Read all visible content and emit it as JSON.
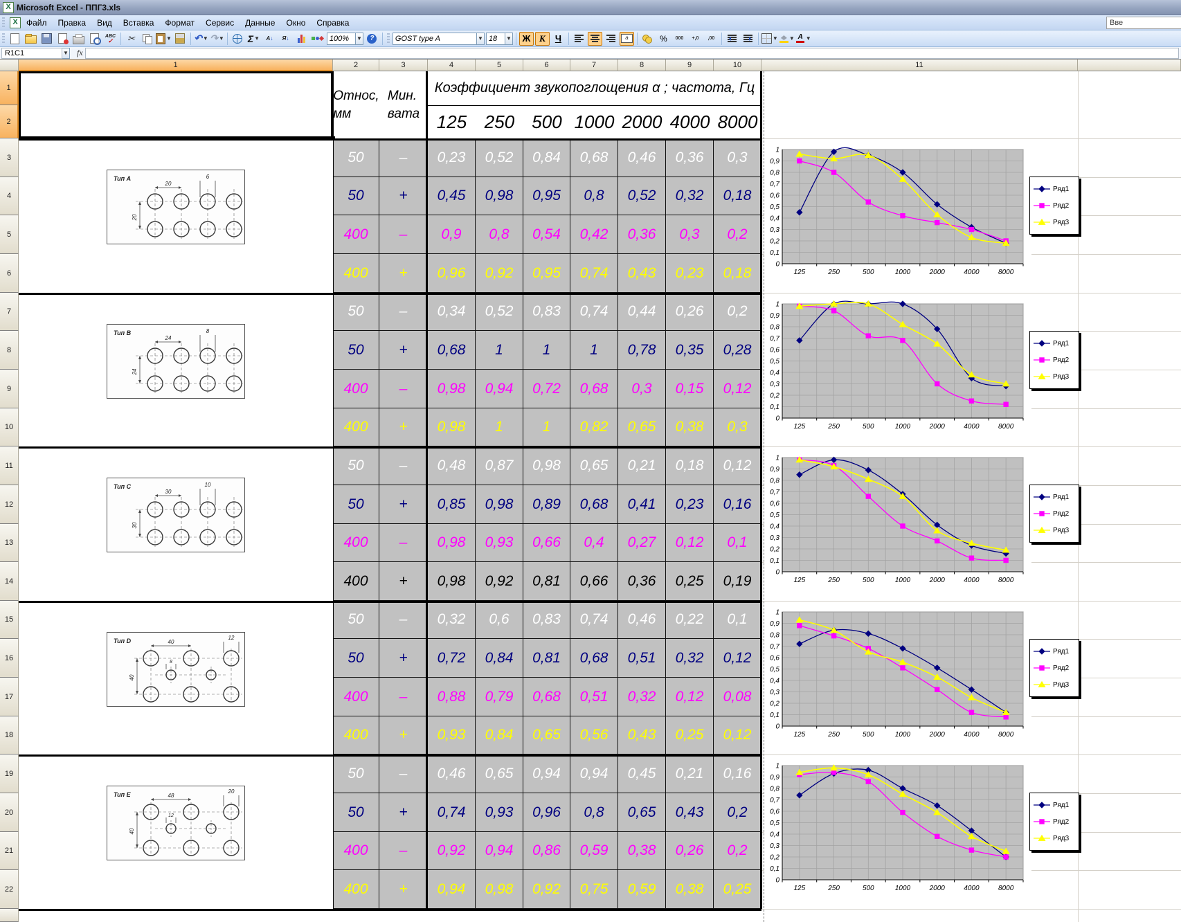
{
  "window": {
    "title": "Microsoft Excel - ППГ3.xls"
  },
  "menu": {
    "items": [
      "Файл",
      "Правка",
      "Вид",
      "Вставка",
      "Формат",
      "Сервис",
      "Данные",
      "Окно",
      "Справка"
    ],
    "question_box": "Вве"
  },
  "toolbar": {
    "zoom_value": "100%",
    "font_name": "GOST type A",
    "font_size": "18",
    "bold_label": "Ж",
    "italic_label": "К",
    "underline_label": "Ч",
    "percent_label": "%",
    "thousands_label": "000",
    "inc_decimal_label": "+,0",
    "dec_decimal_label": ",00",
    "font_color_label": "А",
    "help_label": "?",
    "sort_az_label": "А",
    "sort_za_label": "Я"
  },
  "formula_bar": {
    "name_box": "R1C1",
    "fx": "fx"
  },
  "sheet": {
    "col_headers": [
      "1",
      "2",
      "3",
      "4",
      "5",
      "6",
      "7",
      "8",
      "9",
      "10",
      "11"
    ],
    "row_headers": [
      "1",
      "2",
      "3",
      "4",
      "5",
      "6",
      "7",
      "8",
      "9",
      "10",
      "11",
      "12",
      "13",
      "14",
      "15",
      "16",
      "17",
      "18",
      "19",
      "20",
      "21",
      "22"
    ],
    "header": {
      "col2_line1": "Относ,",
      "col2_line2": "мм",
      "col3_line1": "Мин.",
      "col3_line2": "вата",
      "title": "Коэффициент звукопоглощения α ; частота, Гц",
      "frequencies": [
        "125",
        "250",
        "500",
        "1000",
        "2000",
        "4000",
        "8000"
      ]
    },
    "blocks": [
      {
        "id": "a",
        "drawing": {
          "label": "Тип A",
          "pattern": "grid",
          "pitch": "20",
          "dia": "6",
          "vpitch": "20"
        },
        "rows": [
          {
            "offset": "50",
            "wool": "–",
            "color": "#ffffff",
            "values": [
              "0,23",
              "0,52",
              "0,84",
              "0,68",
              "0,46",
              "0,36",
              "0,3"
            ]
          },
          {
            "offset": "50",
            "wool": "+",
            "color": "#000080",
            "values": [
              "0,45",
              "0,98",
              "0,95",
              "0,8",
              "0,52",
              "0,32",
              "0,18"
            ]
          },
          {
            "offset": "400",
            "wool": "–",
            "color": "#ff00ff",
            "values": [
              "0,9",
              "0,8",
              "0,54",
              "0,42",
              "0,36",
              "0,3",
              "0,2"
            ]
          },
          {
            "offset": "400",
            "wool": "+",
            "color": "#ffff00",
            "values": [
              "0,96",
              "0,92",
              "0,95",
              "0,74",
              "0,43",
              "0,23",
              "0,18"
            ]
          }
        ]
      },
      {
        "id": "b",
        "drawing": {
          "label": "Тип B",
          "pattern": "grid",
          "pitch": "24",
          "dia": "8",
          "vpitch": "24"
        },
        "rows": [
          {
            "offset": "50",
            "wool": "–",
            "color": "#ffffff",
            "values": [
              "0,34",
              "0,52",
              "0,83",
              "0,74",
              "0,44",
              "0,26",
              "0,2"
            ]
          },
          {
            "offset": "50",
            "wool": "+",
            "color": "#000080",
            "values": [
              "0,68",
              "1",
              "1",
              "1",
              "0,78",
              "0,35",
              "0,28"
            ]
          },
          {
            "offset": "400",
            "wool": "–",
            "color": "#ff00ff",
            "values": [
              "0,98",
              "0,94",
              "0,72",
              "0,68",
              "0,3",
              "0,15",
              "0,12"
            ]
          },
          {
            "offset": "400",
            "wool": "+",
            "color": "#ffff00",
            "values": [
              "0,98",
              "1",
              "1",
              "0,82",
              "0,65",
              "0,38",
              "0,3"
            ]
          }
        ]
      },
      {
        "id": "c",
        "drawing": {
          "label": "Тип C",
          "pattern": "grid",
          "pitch": "30",
          "dia": "10",
          "vpitch": "30"
        },
        "rows": [
          {
            "offset": "50",
            "wool": "–",
            "color": "#ffffff",
            "values": [
              "0,48",
              "0,87",
              "0,98",
              "0,65",
              "0,21",
              "0,18",
              "0,12"
            ]
          },
          {
            "offset": "50",
            "wool": "+",
            "color": "#000080",
            "values": [
              "0,85",
              "0,98",
              "0,89",
              "0,68",
              "0,41",
              "0,23",
              "0,16"
            ]
          },
          {
            "offset": "400",
            "wool": "–",
            "color": "#ff00ff",
            "values": [
              "0,98",
              "0,93",
              "0,66",
              "0,4",
              "0,27",
              "0,12",
              "0,1"
            ]
          },
          {
            "offset": "400",
            "wool": "+",
            "color": "#000000",
            "values": [
              "0,98",
              "0,92",
              "0,81",
              "0,66",
              "0,36",
              "0,25",
              "0,19"
            ]
          }
        ]
      },
      {
        "id": "d",
        "drawing": {
          "label": "Тип D",
          "pattern": "staggered",
          "pitch": "40",
          "dia": "12",
          "vpitch": "40",
          "mid": "8"
        },
        "rows": [
          {
            "offset": "50",
            "wool": "–",
            "color": "#ffffff",
            "values": [
              "0,32",
              "0,6",
              "0,83",
              "0,74",
              "0,46",
              "0,22",
              "0,1"
            ]
          },
          {
            "offset": "50",
            "wool": "+",
            "color": "#000080",
            "values": [
              "0,72",
              "0,84",
              "0,81",
              "0,68",
              "0,51",
              "0,32",
              "0,12"
            ]
          },
          {
            "offset": "400",
            "wool": "–",
            "color": "#ff00ff",
            "values": [
              "0,88",
              "0,79",
              "0,68",
              "0,51",
              "0,32",
              "0,12",
              "0,08"
            ]
          },
          {
            "offset": "400",
            "wool": "+",
            "color": "#ffff00",
            "values": [
              "0,93",
              "0,84",
              "0,65",
              "0,56",
              "0,43",
              "0,25",
              "0,12"
            ]
          }
        ]
      },
      {
        "id": "e",
        "drawing": {
          "label": "Тип E",
          "pattern": "staggered",
          "pitch": "48",
          "dia": "20",
          "vpitch": "40",
          "mid": "12"
        },
        "rows": [
          {
            "offset": "50",
            "wool": "–",
            "color": "#ffffff",
            "values": [
              "0,46",
              "0,65",
              "0,94",
              "0,94",
              "0,45",
              "0,21",
              "0,16"
            ]
          },
          {
            "offset": "50",
            "wool": "+",
            "color": "#000080",
            "values": [
              "0,74",
              "0,93",
              "0,96",
              "0,8",
              "0,65",
              "0,43",
              "0,2"
            ]
          },
          {
            "offset": "400",
            "wool": "–",
            "color": "#ff00ff",
            "values": [
              "0,92",
              "0,94",
              "0,86",
              "0,59",
              "0,38",
              "0,26",
              "0,2"
            ]
          },
          {
            "offset": "400",
            "wool": "+",
            "color": "#ffff00",
            "values": [
              "0,94",
              "0,98",
              "0,92",
              "0,75",
              "0,59",
              "0,38",
              "0,25"
            ]
          }
        ]
      }
    ]
  },
  "chart_data": [
    {
      "type": "line",
      "smoothed": true,
      "x": [
        "125",
        "250",
        "500",
        "1000",
        "2000",
        "4000",
        "8000"
      ],
      "ylim": [
        0,
        1
      ],
      "yticks": [
        "1",
        "0,9",
        "0,8",
        "0,7",
        "0,6",
        "0,5",
        "0,4",
        "0,3",
        "0,2",
        "0,1",
        "0"
      ],
      "legend_position": "right",
      "plot_bg": "#c0c0c0",
      "series": [
        {
          "name": "Ряд1",
          "color": "#000080",
          "marker": "diamond",
          "values": [
            0.45,
            0.98,
            0.95,
            0.8,
            0.52,
            0.32,
            0.18
          ]
        },
        {
          "name": "Ряд2",
          "color": "#ff00ff",
          "marker": "square",
          "values": [
            0.9,
            0.8,
            0.54,
            0.42,
            0.36,
            0.3,
            0.2
          ]
        },
        {
          "name": "Ряд3",
          "color": "#ffff00",
          "marker": "triangle",
          "values": [
            0.96,
            0.92,
            0.95,
            0.74,
            0.43,
            0.23,
            0.18
          ]
        }
      ]
    },
    {
      "type": "line",
      "smoothed": true,
      "x": [
        "125",
        "250",
        "500",
        "1000",
        "2000",
        "4000",
        "8000"
      ],
      "ylim": [
        0,
        1
      ],
      "yticks": [
        "1",
        "0,9",
        "0,8",
        "0,7",
        "0,6",
        "0,5",
        "0,4",
        "0,3",
        "0,2",
        "0,1",
        "0"
      ],
      "legend_position": "right",
      "plot_bg": "#c0c0c0",
      "series": [
        {
          "name": "Ряд1",
          "color": "#000080",
          "marker": "diamond",
          "values": [
            0.68,
            1,
            1,
            1,
            0.78,
            0.35,
            0.28
          ]
        },
        {
          "name": "Ряд2",
          "color": "#ff00ff",
          "marker": "square",
          "values": [
            0.98,
            0.94,
            0.72,
            0.68,
            0.3,
            0.15,
            0.12
          ]
        },
        {
          "name": "Ряд3",
          "color": "#ffff00",
          "marker": "triangle",
          "values": [
            0.98,
            1,
            1,
            0.82,
            0.65,
            0.38,
            0.3
          ]
        }
      ]
    },
    {
      "type": "line",
      "smoothed": true,
      "x": [
        "125",
        "250",
        "500",
        "1000",
        "2000",
        "4000",
        "8000"
      ],
      "ylim": [
        0,
        1
      ],
      "yticks": [
        "1",
        "0,9",
        "0,8",
        "0,7",
        "0,6",
        "0,5",
        "0,4",
        "0,3",
        "0,2",
        "0,1",
        "0"
      ],
      "legend_position": "right",
      "plot_bg": "#c0c0c0",
      "series": [
        {
          "name": "Ряд1",
          "color": "#000080",
          "marker": "diamond",
          "values": [
            0.85,
            0.98,
            0.89,
            0.68,
            0.41,
            0.23,
            0.16
          ]
        },
        {
          "name": "Ряд2",
          "color": "#ff00ff",
          "marker": "square",
          "values": [
            0.98,
            0.93,
            0.66,
            0.4,
            0.27,
            0.12,
            0.1
          ]
        },
        {
          "name": "Ряд3",
          "color": "#ffff00",
          "marker": "triangle",
          "values": [
            0.98,
            0.92,
            0.81,
            0.66,
            0.36,
            0.25,
            0.19
          ]
        }
      ]
    },
    {
      "type": "line",
      "smoothed": true,
      "x": [
        "125",
        "250",
        "500",
        "1000",
        "2000",
        "4000",
        "8000"
      ],
      "ylim": [
        0,
        1
      ],
      "yticks": [
        "1",
        "0,9",
        "0,8",
        "0,7",
        "0,6",
        "0,5",
        "0,4",
        "0,3",
        "0,2",
        "0,1",
        "0"
      ],
      "legend_position": "right",
      "plot_bg": "#c0c0c0",
      "series": [
        {
          "name": "Ряд1",
          "color": "#000080",
          "marker": "diamond",
          "values": [
            0.72,
            0.84,
            0.81,
            0.68,
            0.51,
            0.32,
            0.12
          ]
        },
        {
          "name": "Ряд2",
          "color": "#ff00ff",
          "marker": "square",
          "values": [
            0.88,
            0.79,
            0.68,
            0.51,
            0.32,
            0.12,
            0.08
          ]
        },
        {
          "name": "Ряд3",
          "color": "#ffff00",
          "marker": "triangle",
          "values": [
            0.93,
            0.84,
            0.65,
            0.56,
            0.43,
            0.25,
            0.12
          ]
        }
      ]
    },
    {
      "type": "line",
      "smoothed": true,
      "x": [
        "125",
        "250",
        "500",
        "1000",
        "2000",
        "4000",
        "8000"
      ],
      "ylim": [
        0,
        1
      ],
      "yticks": [
        "1",
        "0,9",
        "0,8",
        "0,7",
        "0,6",
        "0,5",
        "0,4",
        "0,3",
        "0,2",
        "0,1",
        "0"
      ],
      "legend_position": "right",
      "plot_bg": "#c0c0c0",
      "series": [
        {
          "name": "Ряд1",
          "color": "#000080",
          "marker": "diamond",
          "values": [
            0.74,
            0.93,
            0.96,
            0.8,
            0.65,
            0.43,
            0.2
          ]
        },
        {
          "name": "Ряд2",
          "color": "#ff00ff",
          "marker": "square",
          "values": [
            0.92,
            0.94,
            0.86,
            0.59,
            0.38,
            0.26,
            0.2
          ]
        },
        {
          "name": "Ряд3",
          "color": "#ffff00",
          "marker": "triangle",
          "values": [
            0.94,
            0.98,
            0.92,
            0.75,
            0.59,
            0.38,
            0.25
          ]
        }
      ]
    }
  ],
  "colors": {
    "grid_cell": "#c1c1c1",
    "plot_bg": "#c0c0c0",
    "row_white": "#ffffff",
    "row_blue": "#000080",
    "row_magenta": "#ff00ff",
    "row_yellow": "#ffff00",
    "row_black": "#000000",
    "header_selected": "#f8b25f"
  }
}
